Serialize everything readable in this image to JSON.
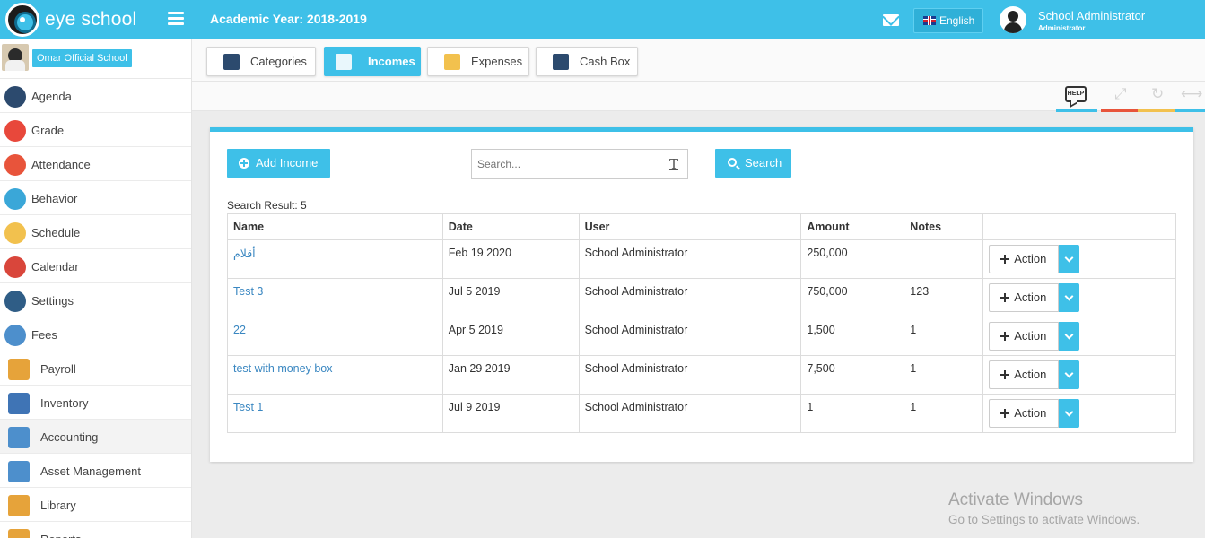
{
  "header": {
    "brand": "eye school",
    "academic_year": "Academic Year: 2018-2019",
    "language": "English",
    "user_name": "School Administrator",
    "user_role": "Administrator",
    "accent_color": "#3ec0e8"
  },
  "sidebar": {
    "school_name": "Omar Official School",
    "items": [
      {
        "label": "Agenda",
        "icon": "agenda-icon",
        "color": "#2c4a6e"
      },
      {
        "label": "Grade",
        "icon": "grade-icon",
        "color": "#e8483b"
      },
      {
        "label": "Attendance",
        "icon": "attendance-icon",
        "color": "#e8543b"
      },
      {
        "label": "Behavior",
        "icon": "behavior-icon",
        "color": "#3aa7d8"
      },
      {
        "label": "Schedule",
        "icon": "schedule-icon",
        "color": "#f2c14e"
      },
      {
        "label": "Calendar",
        "icon": "calendar-icon",
        "color": "#d9463b"
      },
      {
        "label": "Settings",
        "icon": "settings-icon",
        "color": "#2f5d86"
      },
      {
        "label": "Fees",
        "icon": "fees-icon",
        "color": "#4d8fcc"
      },
      {
        "label": "Payroll",
        "icon": "payroll-icon",
        "color": "#e6a33a"
      },
      {
        "label": "Inventory",
        "icon": "inventory-icon",
        "color": "#3f74b5"
      },
      {
        "label": "Accounting",
        "icon": "accounting-icon",
        "color": "#4d8fcc"
      },
      {
        "label": "Asset Management",
        "icon": "asset-management-icon",
        "color": "#4d8fcc"
      },
      {
        "label": "Library",
        "icon": "library-icon",
        "color": "#e6a33a"
      },
      {
        "label": "Reports",
        "icon": "reports-icon",
        "color": "#e6a33a"
      }
    ]
  },
  "tabs": [
    {
      "label": "Categories",
      "icon": "categories-icon",
      "active": false
    },
    {
      "label": "Incomes",
      "icon": "incomes-icon",
      "active": true
    },
    {
      "label": "Expenses",
      "icon": "expenses-icon",
      "active": false
    },
    {
      "label": "Cash Box",
      "icon": "cash-box-icon",
      "active": false
    }
  ],
  "tools": {
    "help_label": "HELP",
    "help_color": "#3ec0e8",
    "fullscreen_color": "#e8543b",
    "refresh_color": "#f2c14e",
    "collapse_color": "#3ec0e8"
  },
  "panel": {
    "add_label": "Add Income",
    "search_placeholder": "Search...",
    "search_label": "Search",
    "result_text": "Search Result: 5"
  },
  "table": {
    "columns": [
      "Name",
      "Date",
      "User",
      "Amount",
      "Notes",
      ""
    ],
    "rows": [
      {
        "name": "أقلام",
        "date": "Feb 19 2020",
        "user": "School Administrator",
        "amount": "250,000",
        "notes": "",
        "action": "Action"
      },
      {
        "name": "Test 3",
        "date": "Jul 5 2019",
        "user": "School Administrator",
        "amount": "750,000",
        "notes": "123",
        "action": "Action"
      },
      {
        "name": "22",
        "date": "Apr 5 2019",
        "user": "School Administrator",
        "amount": "1,500",
        "notes": "1",
        "action": "Action"
      },
      {
        "name": "test with money box",
        "date": "Jan 29 2019",
        "user": "School Administrator",
        "amount": "7,500",
        "notes": "1",
        "action": "Action"
      },
      {
        "name": "Test 1",
        "date": "Jul 9 2019",
        "user": "School Administrator",
        "amount": "1",
        "notes": "1",
        "action": "Action"
      }
    ]
  },
  "watermark": {
    "line1": "Activate Windows",
    "line2": "Go to Settings to activate Windows."
  }
}
